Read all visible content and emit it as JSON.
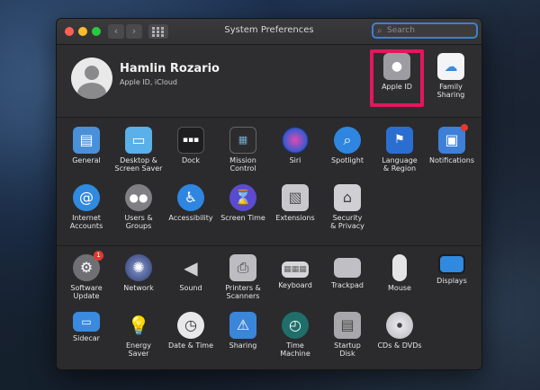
{
  "window": {
    "title": "System Preferences"
  },
  "search": {
    "placeholder": "Search"
  },
  "account": {
    "name": "Hamlin Rozario",
    "subtitle": "Apple ID, iCloud",
    "apple_id_label": "Apple ID",
    "family_sharing_label": "Family\nSharing"
  },
  "panes_row1": [
    {
      "label": "General",
      "icon": "general-icon",
      "color": "#4a90d9"
    },
    {
      "label": "Desktop &\nScreen Saver",
      "icon": "desktop-icon",
      "color": "#5ab0e8"
    },
    {
      "label": "Dock",
      "icon": "dock-icon",
      "color": "#1e1e20"
    },
    {
      "label": "Mission\nControl",
      "icon": "mission-control-icon",
      "color": "#2c2c2e"
    },
    {
      "label": "Siri",
      "icon": "siri-icon",
      "color": "#7a3fd0"
    },
    {
      "label": "Spotlight",
      "icon": "spotlight-icon",
      "color": "#2f86e0"
    },
    {
      "label": "Language\n& Region",
      "icon": "language-region-icon",
      "color": "#2a6fd0"
    },
    {
      "label": "Notifications",
      "icon": "notifications-icon",
      "color": "#3e7fd8"
    }
  ],
  "panes_row2": [
    {
      "label": "Internet\nAccounts",
      "icon": "internet-accounts-icon",
      "color": "#2f8ae0"
    },
    {
      "label": "Users &\nGroups",
      "icon": "users-groups-icon",
      "color": "#808084"
    },
    {
      "label": "Accessibility",
      "icon": "accessibility-icon",
      "color": "#2f86e0"
    },
    {
      "label": "Screen Time",
      "icon": "screen-time-icon",
      "color": "#5b4bd0"
    },
    {
      "label": "Extensions",
      "icon": "extensions-icon",
      "color": "#c8c8cc"
    },
    {
      "label": "Security\n& Privacy",
      "icon": "security-privacy-icon",
      "color": "#d0d0d4"
    }
  ],
  "panes_row3": [
    {
      "label": "Software\nUpdate",
      "icon": "software-update-icon",
      "color": "#707074",
      "badge": "1"
    },
    {
      "label": "Network",
      "icon": "network-icon",
      "color": "#4a5a90"
    },
    {
      "label": "Sound",
      "icon": "sound-icon",
      "color": "#555558"
    },
    {
      "label": "Printers &\nScanners",
      "icon": "printers-scanners-icon",
      "color": "#bdbdc1"
    },
    {
      "label": "Keyboard",
      "icon": "keyboard-icon",
      "color": "#d6d6da"
    },
    {
      "label": "Trackpad",
      "icon": "trackpad-icon",
      "color": "#c0c0c4"
    },
    {
      "label": "Mouse",
      "icon": "mouse-icon",
      "color": "#e4e4e6"
    },
    {
      "label": "Displays",
      "icon": "displays-icon",
      "color": "#2f8ae0"
    }
  ],
  "panes_row4": [
    {
      "label": "Sidecar",
      "icon": "sidecar-icon",
      "color": "#3a8ae0"
    },
    {
      "label": "Energy\nSaver",
      "icon": "energy-saver-icon",
      "color": "#f0d060"
    },
    {
      "label": "Date & Time",
      "icon": "date-time-icon",
      "color": "#e8e8ea"
    },
    {
      "label": "Sharing",
      "icon": "sharing-icon",
      "color": "#3a86d8"
    },
    {
      "label": "Time\nMachine",
      "icon": "time-machine-icon",
      "color": "#1f6e6a"
    },
    {
      "label": "Startup\nDisk",
      "icon": "startup-disk-icon",
      "color": "#a8a8ac"
    },
    {
      "label": "CDs & DVDs",
      "icon": "cds-dvds-icon",
      "color": "#d8d8dc"
    }
  ],
  "colors": {
    "highlight": "#e0185e",
    "window_bg": "#2b2b2d"
  }
}
